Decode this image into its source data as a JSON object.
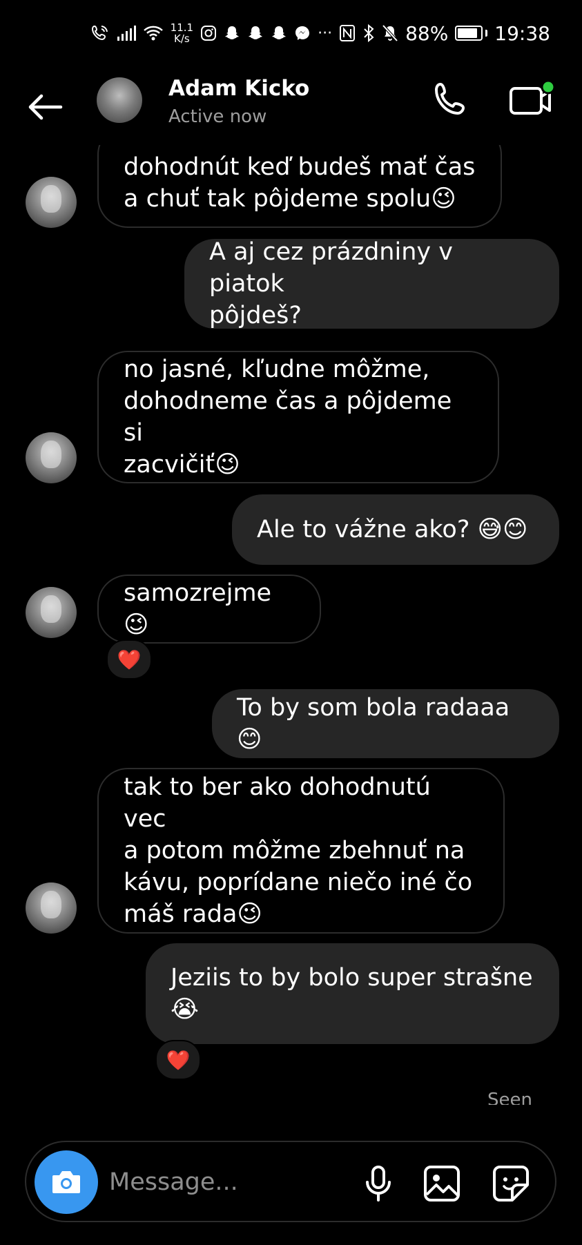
{
  "status_bar": {
    "net_speed_value": "11.1",
    "net_speed_unit": "K/s",
    "battery_percent": "88%",
    "battery_level": 0.88,
    "time": "19:38"
  },
  "header": {
    "contact_name": "Adam Kicko",
    "presence": "Active now"
  },
  "messages": [
    {
      "dir": "in",
      "lines": [
        "dohodnút keď budeš mať čas",
        "a chuť tak pôjdeme spolu😉"
      ]
    },
    {
      "dir": "out",
      "lines": [
        "A aj cez prázdniny v piatok",
        "pôjdeš?"
      ]
    },
    {
      "dir": "in",
      "lines": [
        "no jasné, kľudne môžme,",
        "dohodneme čas a pôjdeme si",
        "zacvičiť😉"
      ]
    },
    {
      "dir": "out",
      "lines": [
        "Ale to vážne ako? 😅😊"
      ]
    },
    {
      "dir": "in",
      "lines": [
        "samozrejme😉"
      ],
      "reaction": "❤️"
    },
    {
      "dir": "out",
      "lines": [
        "To by som bola radaaa😊"
      ]
    },
    {
      "dir": "in",
      "lines": [
        "tak to ber ako dohodnutú vec",
        "a potom môžme zbehnuť na",
        "kávu, poprídane niečo iné čo",
        "máš rada😉"
      ]
    },
    {
      "dir": "out",
      "lines": [
        "Jeziis to by bolo super strašne",
        "😭"
      ],
      "reaction": "❤️"
    }
  ],
  "seen_label": "Seen",
  "composer": {
    "placeholder": "Message..."
  },
  "icons": {
    "back": "arrow-left-icon",
    "call": "phone-icon",
    "video": "video-camera-icon",
    "camera": "camera-icon",
    "mic": "microphone-icon",
    "gallery": "image-icon",
    "sticker": "sticker-icon"
  },
  "colors": {
    "background": "#000000",
    "outgoing_bubble": "#262626",
    "incoming_border": "#2c2c2c",
    "accent_blue": "#3897f0",
    "online_dot": "#2ecc40",
    "muted_text": "#9e9e9e"
  }
}
